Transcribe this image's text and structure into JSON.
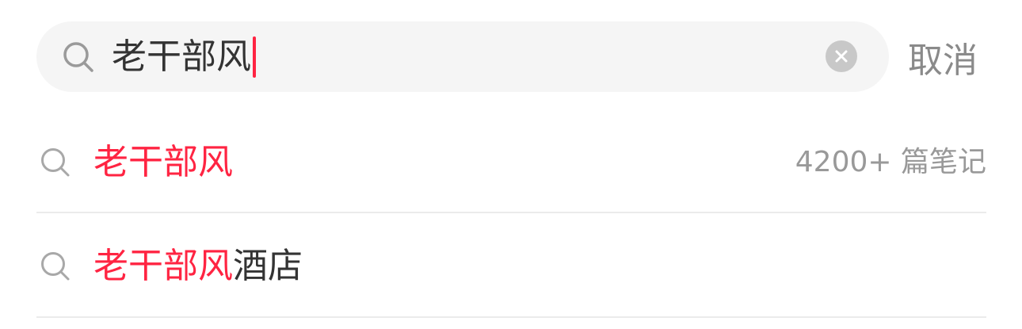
{
  "search": {
    "query": "老干部风",
    "cancel_label": "取消"
  },
  "suggestions": [
    {
      "highlight": "老干部风",
      "rest": "",
      "count": "4200+ 篇笔记"
    },
    {
      "highlight": "老干部风",
      "rest": "酒店",
      "count": ""
    }
  ],
  "colors": {
    "accent": "#ff2442",
    "search_bg": "#f5f5f5",
    "muted_text": "#999999"
  },
  "icons": {
    "search": "search-icon",
    "clear": "clear-icon"
  }
}
